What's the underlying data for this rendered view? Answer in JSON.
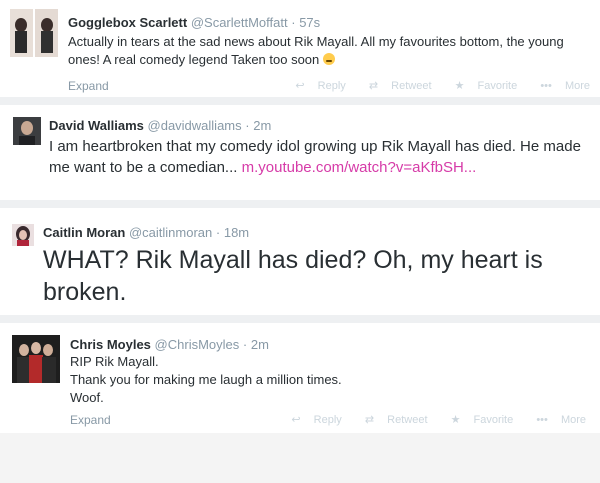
{
  "tweets": [
    {
      "name": "Gogglebox Scarlett",
      "handle": "@ScarlettMoffatt",
      "time": "57s",
      "text": "Actually in tears at the sad news about Rik Mayall. All my favourites bottom, the young ones! A real comedy legend Taken too soon",
      "expand": "Expand",
      "actions": {
        "reply": "Reply",
        "retweet": "Retweet",
        "favorite": "Favorite",
        "more": "More"
      }
    },
    {
      "name": "David Walliams",
      "handle": "@davidwalliams",
      "time": "2m",
      "text": "I am heartbroken that my comedy idol growing up Rik Mayall has died. He made me want to be a comedian...",
      "link": "m.youtube.com/watch?v=aKfbSH..."
    },
    {
      "name": "Caitlin Moran",
      "handle": "@caitlinmoran",
      "time": "18m",
      "text": "WHAT? Rik Mayall has died? Oh, my heart is broken."
    },
    {
      "name": "Chris Moyles",
      "handle": "@ChrisMoyles",
      "time": "2m",
      "lines": [
        "RIP Rik Mayall.",
        "Thank you for making me laugh a million times.",
        "Woof."
      ],
      "expand": "Expand",
      "actions": {
        "reply": "Reply",
        "retweet": "Retweet",
        "favorite": "Favorite",
        "more": "More"
      }
    }
  ],
  "separator_dot": "·",
  "colors": {
    "link": "#d63ba8",
    "muted": "#8899a6",
    "text": "#292f33"
  }
}
